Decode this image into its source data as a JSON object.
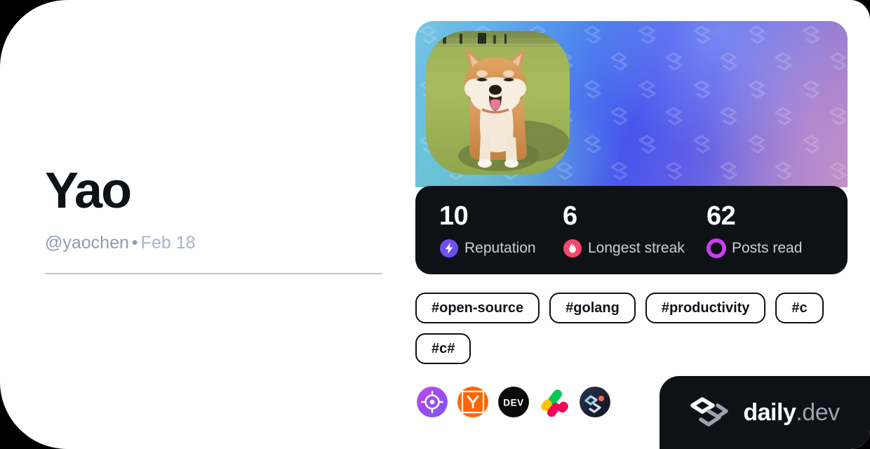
{
  "card": {
    "background_color": "#ffffff",
    "page_background": "#000000"
  },
  "profile": {
    "name": "Yao",
    "username": "@yaochen",
    "separator": "•",
    "joined_date": "Feb 18",
    "avatar_alt": "Shiba Inu dog sitting on grass"
  },
  "cover": {
    "watermark": "daily.dev logo pattern",
    "gradient_from": "#79C6E0",
    "gradient_to": "#B98FC4"
  },
  "stats": [
    {
      "value": "10",
      "label": "Reputation",
      "icon": "reputation-bolt-icon",
      "color": "#6E4FF6"
    },
    {
      "value": "6",
      "label": "Longest streak",
      "icon": "streak-flame-icon",
      "color": "#F6476C"
    },
    {
      "value": "62",
      "label": "Posts read",
      "icon": "posts-read-ring-icon",
      "color": "#CE3DF3"
    }
  ],
  "tags": [
    {
      "label": "#open-source"
    },
    {
      "label": "#golang"
    },
    {
      "label": "#productivity"
    },
    {
      "label": "#c"
    },
    {
      "label": "#c#"
    }
  ],
  "sources": [
    {
      "name": "source-icon-target",
      "title": "Target"
    },
    {
      "name": "source-icon-hackernews",
      "title": "Hacker News"
    },
    {
      "name": "source-icon-devto",
      "title": "DEV",
      "text": "DEV"
    },
    {
      "name": "source-icon-kotlin",
      "title": "Kotlin"
    },
    {
      "name": "source-icon-dailydev",
      "title": "daily.dev"
    }
  ],
  "brand": {
    "name": "daily",
    "tld": ".dev",
    "logo": "dailydev-logo-icon"
  }
}
